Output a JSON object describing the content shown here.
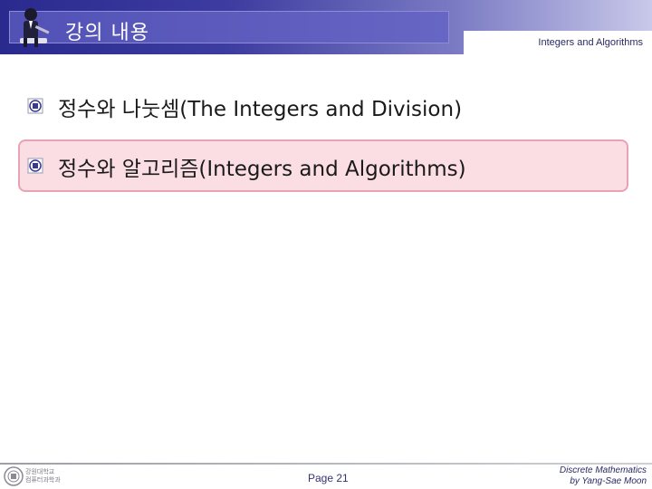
{
  "header": {
    "title": "강의 내용",
    "subtitle": "Integers and Algorithms",
    "icon": "presenter-figure-icon"
  },
  "bullets": [
    {
      "text": "정수와 나눗셈(The Integers and Division)",
      "highlighted": false,
      "icon": "bullet-emblem-icon"
    },
    {
      "text": "정수와 알고리즘(Integers and Algorithms)",
      "highlighted": true,
      "icon": "bullet-emblem-icon"
    }
  ],
  "footer": {
    "logo_text_line1": "강원대학교",
    "logo_text_line2": "컴퓨터과학과",
    "page": "Page 21",
    "credit_line1": "Discrete Mathematics",
    "credit_line2": "by Yang-Sae Moon"
  },
  "colors": {
    "header_dark": "#2a2a8e",
    "header_tab": "#5251b6",
    "highlight_fill": "#fbdde4",
    "highlight_border": "#e7a3b4"
  }
}
